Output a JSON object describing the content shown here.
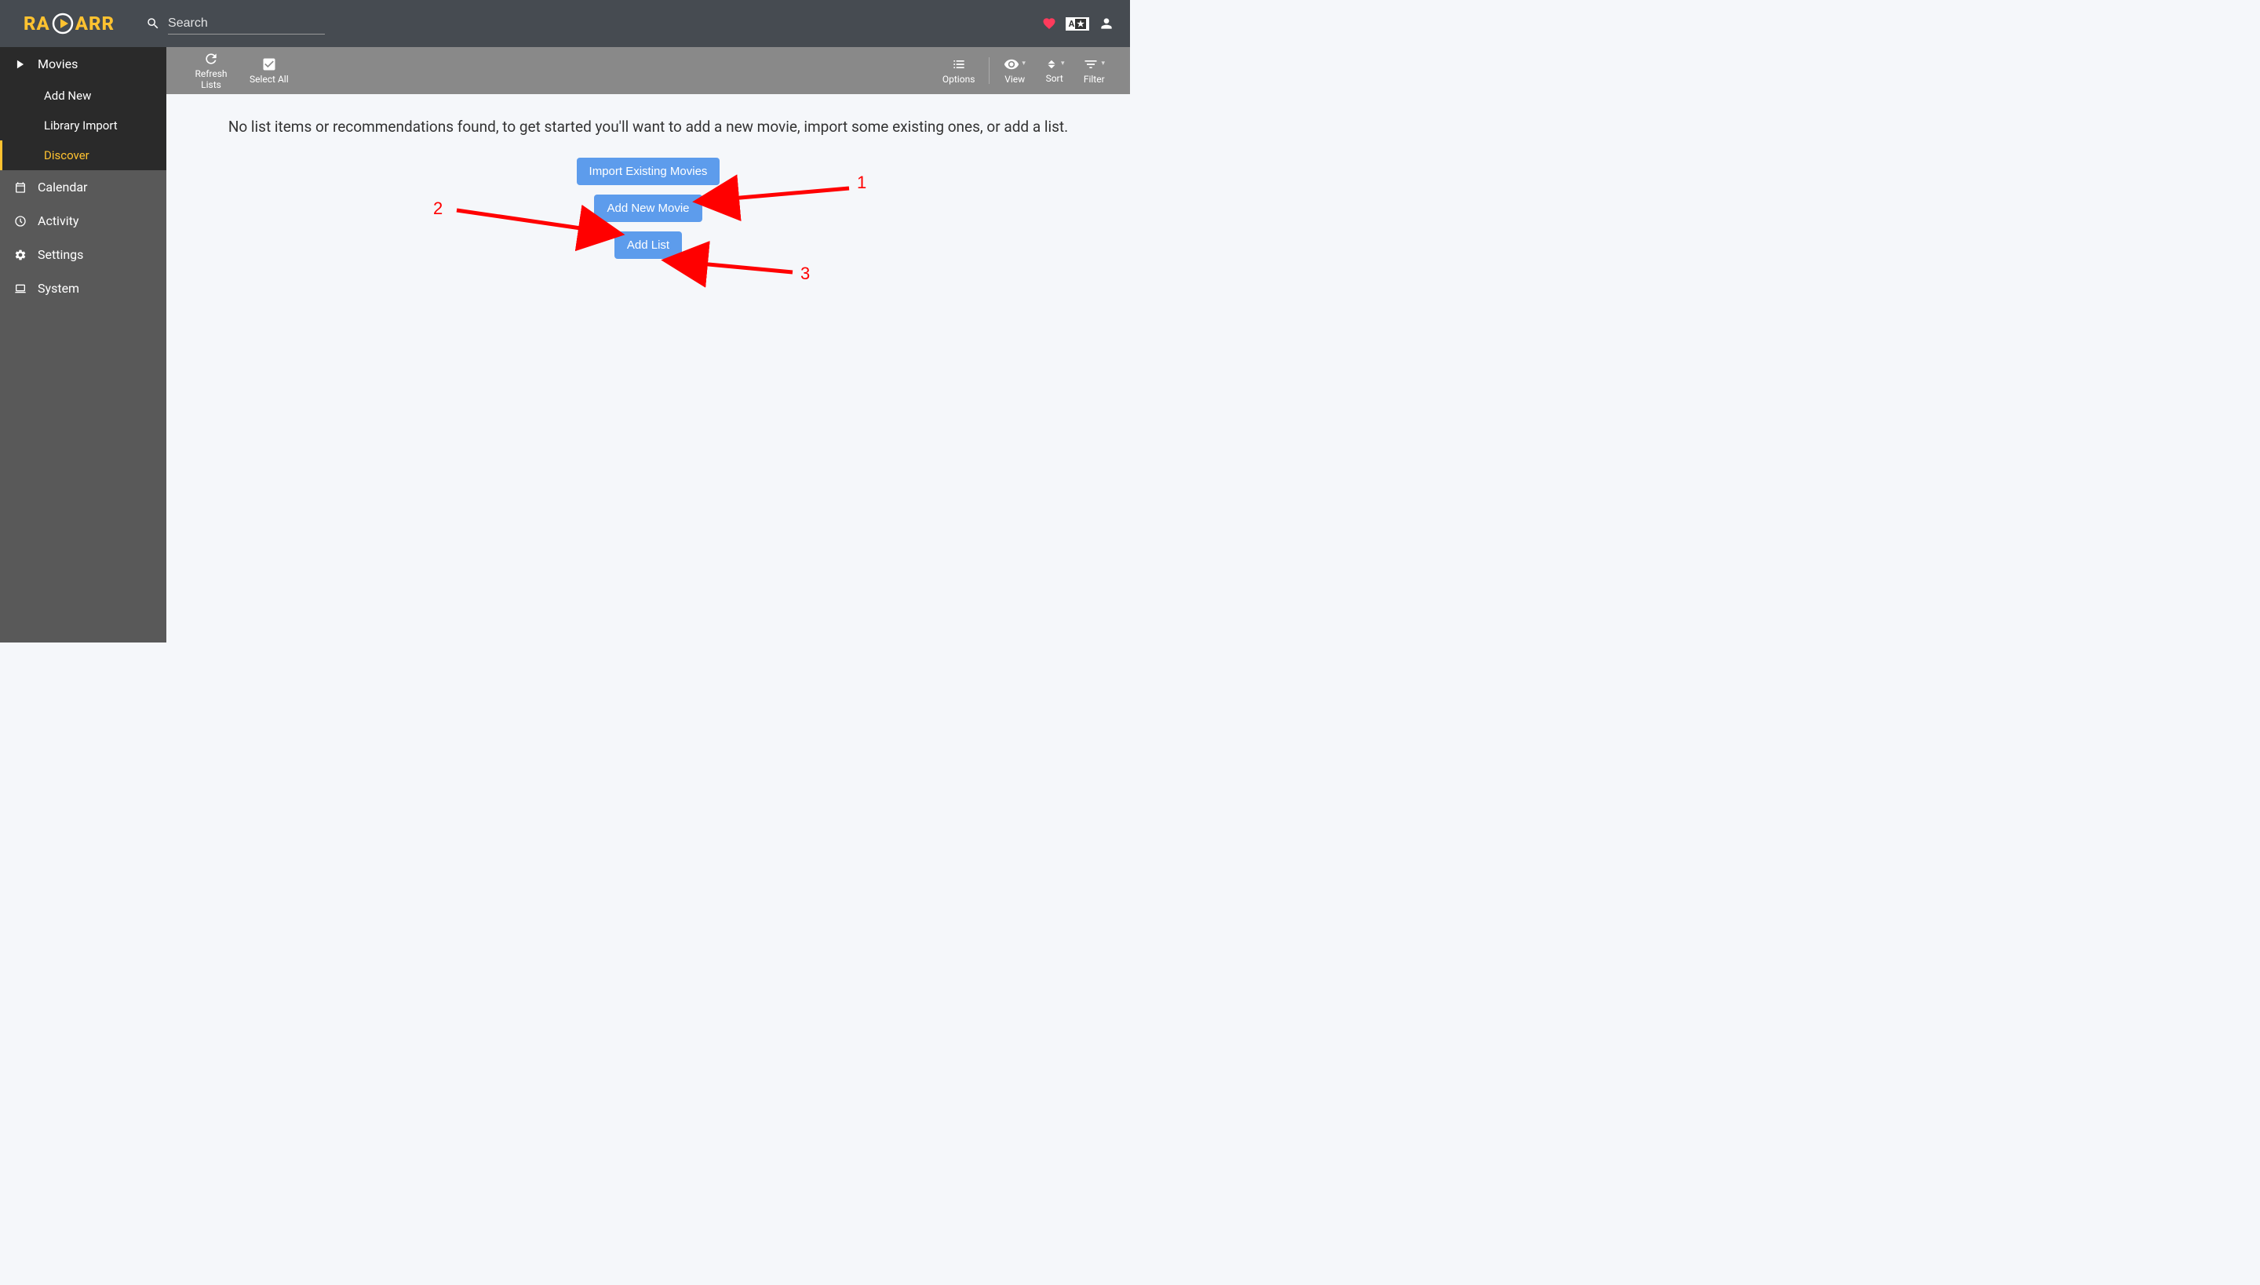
{
  "app": {
    "name_left": "RA",
    "name_right": "ARR"
  },
  "search": {
    "placeholder": "Search"
  },
  "header_icons": {
    "heart": "heart-icon",
    "lang_a": "A",
    "lang_star": "★",
    "user": "user-icon"
  },
  "sidebar": {
    "items": [
      {
        "label": "Movies",
        "icon": "play-icon"
      },
      {
        "label": "Add New",
        "sub": true
      },
      {
        "label": "Library Import",
        "sub": true
      },
      {
        "label": "Discover",
        "sub": true,
        "active": true
      },
      {
        "label": "Calendar",
        "icon": "calendar-icon"
      },
      {
        "label": "Activity",
        "icon": "clock-icon"
      },
      {
        "label": "Settings",
        "icon": "gears-icon"
      },
      {
        "label": "System",
        "icon": "laptop-icon"
      }
    ]
  },
  "toolbar": {
    "refresh": "Refresh Lists",
    "select_all": "Select All",
    "options": "Options",
    "view": "View",
    "sort": "Sort",
    "filter": "Filter"
  },
  "empty": {
    "message": "No list items or recommendations found, to get started you'll want to add a new movie, import some existing ones, or add a list.",
    "buttons": {
      "import": "Import Existing Movies",
      "add_movie": "Add New Movie",
      "add_list": "Add List"
    }
  },
  "annotations": {
    "one": "1",
    "two": "2",
    "three": "3"
  }
}
